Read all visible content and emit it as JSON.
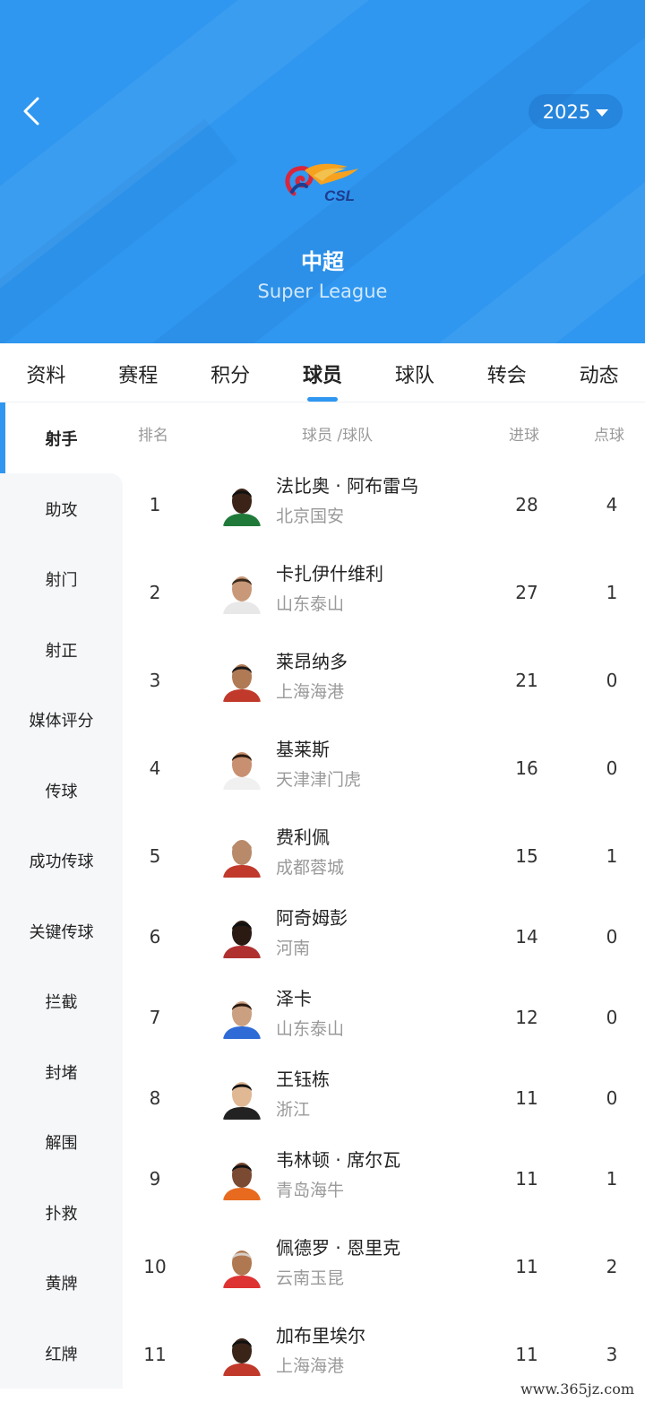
{
  "header": {
    "season": "2025",
    "logo_text": "CSL",
    "league_name": "中超",
    "league_subtitle": "Super League"
  },
  "tabs": [
    {
      "label": "资料",
      "active": false
    },
    {
      "label": "赛程",
      "active": false
    },
    {
      "label": "积分",
      "active": false
    },
    {
      "label": "球员",
      "active": true
    },
    {
      "label": "球队",
      "active": false
    },
    {
      "label": "转会",
      "active": false
    },
    {
      "label": "动态",
      "active": false
    }
  ],
  "sidebar": [
    {
      "label": "射手",
      "active": true
    },
    {
      "label": "助攻",
      "active": false
    },
    {
      "label": "射门",
      "active": false
    },
    {
      "label": "射正",
      "active": false
    },
    {
      "label": "媒体评分",
      "active": false
    },
    {
      "label": "传球",
      "active": false
    },
    {
      "label": "成功传球",
      "active": false
    },
    {
      "label": "关键传球",
      "active": false
    },
    {
      "label": "拦截",
      "active": false
    },
    {
      "label": "封堵",
      "active": false
    },
    {
      "label": "解围",
      "active": false
    },
    {
      "label": "扑救",
      "active": false
    },
    {
      "label": "黄牌",
      "active": false
    },
    {
      "label": "红牌",
      "active": false
    }
  ],
  "table": {
    "headers": {
      "rank": "排名",
      "player_team": "球员 /球队",
      "goals": "进球",
      "penalties": "点球"
    },
    "rows": [
      {
        "rank": "1",
        "player": "法比奥 · 阿布雷乌",
        "team": "北京国安",
        "goals": "28",
        "penalties": "4"
      },
      {
        "rank": "2",
        "player": "卡扎伊什维利",
        "team": "山东泰山",
        "goals": "27",
        "penalties": "1"
      },
      {
        "rank": "3",
        "player": "莱昂纳多",
        "team": "上海海港",
        "goals": "21",
        "penalties": "0"
      },
      {
        "rank": "4",
        "player": "基莱斯",
        "team": "天津津门虎",
        "goals": "16",
        "penalties": "0"
      },
      {
        "rank": "5",
        "player": "费利佩",
        "team": "成都蓉城",
        "goals": "15",
        "penalties": "1"
      },
      {
        "rank": "6",
        "player": "阿奇姆彭",
        "team": "河南",
        "goals": "14",
        "penalties": "0"
      },
      {
        "rank": "7",
        "player": "泽卡",
        "team": "山东泰山",
        "goals": "12",
        "penalties": "0"
      },
      {
        "rank": "8",
        "player": "王钰栋",
        "team": "浙江",
        "goals": "11",
        "penalties": "0"
      },
      {
        "rank": "9",
        "player": "韦林顿 · 席尔瓦",
        "team": "青岛海牛",
        "goals": "11",
        "penalties": "1"
      },
      {
        "rank": "10",
        "player": "佩德罗 · 恩里克",
        "team": "云南玉昆",
        "goals": "11",
        "penalties": "2"
      },
      {
        "rank": "11",
        "player": "加布里埃尔",
        "team": "上海海港",
        "goals": "11",
        "penalties": "3"
      }
    ]
  },
  "watermark": "www.365jz.com",
  "colors": {
    "accent": "#2f97f0",
    "sidebar_bg": "#f6f7f9",
    "muted_text": "#9a9a9a"
  }
}
